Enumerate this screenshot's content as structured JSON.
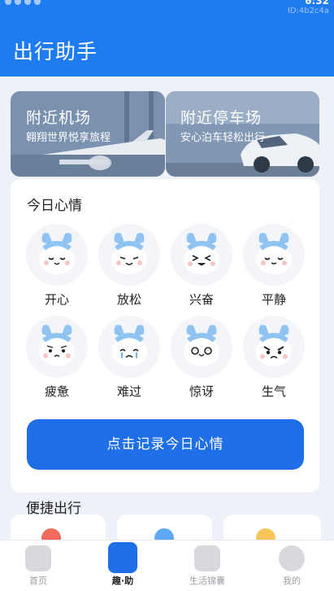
{
  "status": {
    "id_text": "ID:4b2c4a",
    "time": "6:32"
  },
  "app": {
    "title": "出行助手"
  },
  "banners": [
    {
      "title": "附近机场",
      "subtitle": "翱翔世界悦享旅程"
    },
    {
      "title": "附近停车场",
      "subtitle": "安心泊车轻松出行"
    }
  ],
  "mood": {
    "title": "今日心情",
    "items": [
      {
        "label": "开心"
      },
      {
        "label": "放松"
      },
      {
        "label": "兴奋"
      },
      {
        "label": "平静"
      },
      {
        "label": "疲惫"
      },
      {
        "label": "难过"
      },
      {
        "label": "惊讶"
      },
      {
        "label": "生气"
      }
    ],
    "record_button": "点击记录今日心情"
  },
  "quick": {
    "title": "便捷出行"
  },
  "tabs": [
    {
      "label": "首页"
    },
    {
      "label": "趣·助"
    },
    {
      "label": "生活锦囊"
    },
    {
      "label": "我的"
    }
  ],
  "colors": {
    "primary": "#1f7bf0",
    "button": "#1f6fe8",
    "background": "#eef1f7"
  }
}
